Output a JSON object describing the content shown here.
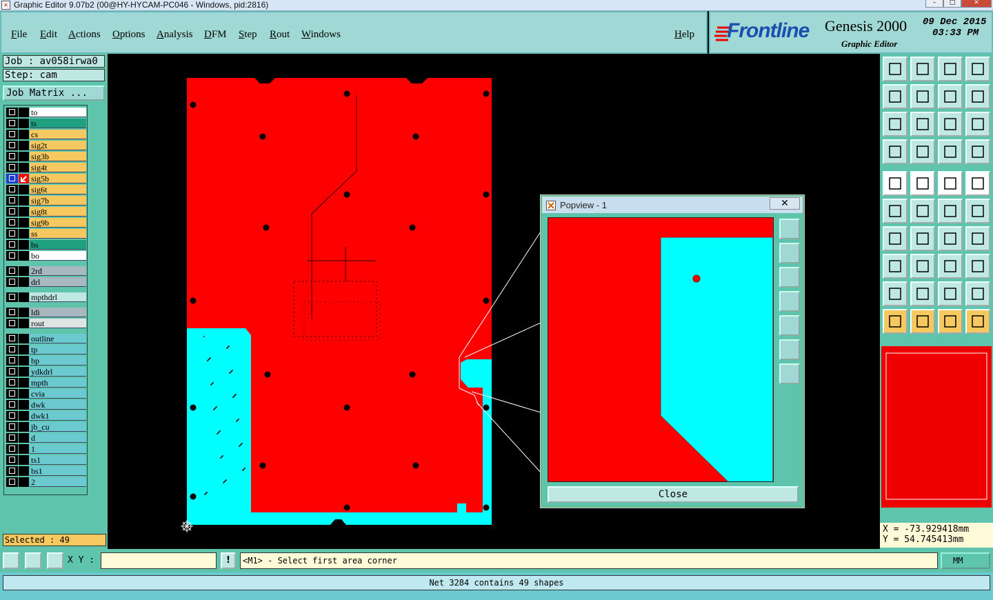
{
  "window": {
    "title": "Graphic Editor 9.07b2 (00@HY-HYCAM-PC046 - Windows, pid:2816)"
  },
  "menu": [
    "File",
    "Edit",
    "Actions",
    "Options",
    "Analysis",
    "DFM",
    "Step",
    "Rout",
    "Windows"
  ],
  "help": "Help",
  "brand": {
    "logo": "Frontline",
    "product": "Genesis 2000",
    "subtitle": "Graphic Editor",
    "date": "09 Dec 2015",
    "time": "03:33 PM"
  },
  "job": {
    "job_label": "Job : av058irwa0",
    "step_label": "Step: cam",
    "matrix_button": "Job Matrix ..."
  },
  "layers": [
    {
      "name": "to",
      "color": "#ffffff"
    },
    {
      "name": "ts",
      "color": "#1fa080"
    },
    {
      "name": "cs",
      "color": "#f5c860"
    },
    {
      "name": "sig2t",
      "color": "#f5c860"
    },
    {
      "name": "sig3b",
      "color": "#f5c860"
    },
    {
      "name": "sig4t",
      "color": "#f5c860"
    },
    {
      "name": "sig5b",
      "color": "#f5c860"
    },
    {
      "name": "sig6t",
      "color": "#f5c860"
    },
    {
      "name": "sig7b",
      "color": "#f5c860"
    },
    {
      "name": "sig8t",
      "color": "#f5c860"
    },
    {
      "name": "sig9b",
      "color": "#f5c860"
    },
    {
      "name": "ss",
      "color": "#f5c860"
    },
    {
      "name": "bs",
      "color": "#1fa080"
    },
    {
      "name": "bo",
      "color": "#ffffff"
    },
    {
      "name": "2rd",
      "color": "#a8b8c0"
    },
    {
      "name": "drl",
      "color": "#a8b8c0"
    },
    {
      "name": "mpthdrl",
      "color": "#bfe8e2"
    },
    {
      "name": "ldi",
      "color": "#a8b8c0"
    },
    {
      "name": "rout",
      "color": "#dde4e4"
    },
    {
      "name": "outline",
      "color": "#6bc9d0"
    },
    {
      "name": "tp",
      "color": "#6bc9d0"
    },
    {
      "name": "bp",
      "color": "#6bc9d0"
    },
    {
      "name": "ydkdrl",
      "color": "#6bc9d0"
    },
    {
      "name": "mpth",
      "color": "#6bc9d0"
    },
    {
      "name": "cvia",
      "color": "#6bc9d0"
    },
    {
      "name": "dwk",
      "color": "#6bc9d0"
    },
    {
      "name": "dwk1",
      "color": "#6bc9d0"
    },
    {
      "name": "jb_cu",
      "color": "#6bc9d0"
    },
    {
      "name": "d",
      "color": "#6bc9d0"
    },
    {
      "name": "1",
      "color": "#6bc9d0"
    },
    {
      "name": "ts1",
      "color": "#6bc9d0"
    },
    {
      "name": "bs1",
      "color": "#6bc9d0"
    },
    {
      "name": "2",
      "color": "#6bc9d0"
    }
  ],
  "selected": "Selected : 49",
  "popview": {
    "title": "Popview - 1",
    "close_icon": "✕",
    "close_button": "Close"
  },
  "coords": {
    "x": "X = -73.929418mm",
    "y": "Y = 54.745413mm"
  },
  "bottom": {
    "xy_label": "X Y :",
    "xy_value": "",
    "excl": "!",
    "prompt": "<M1> - Select first area corner",
    "units": "MM"
  },
  "status": "Net 3284 contains 49 shapes",
  "colors": {
    "copper": "#ff0000",
    "substrate": "#00ffff",
    "panel": "#5ec5ac"
  }
}
